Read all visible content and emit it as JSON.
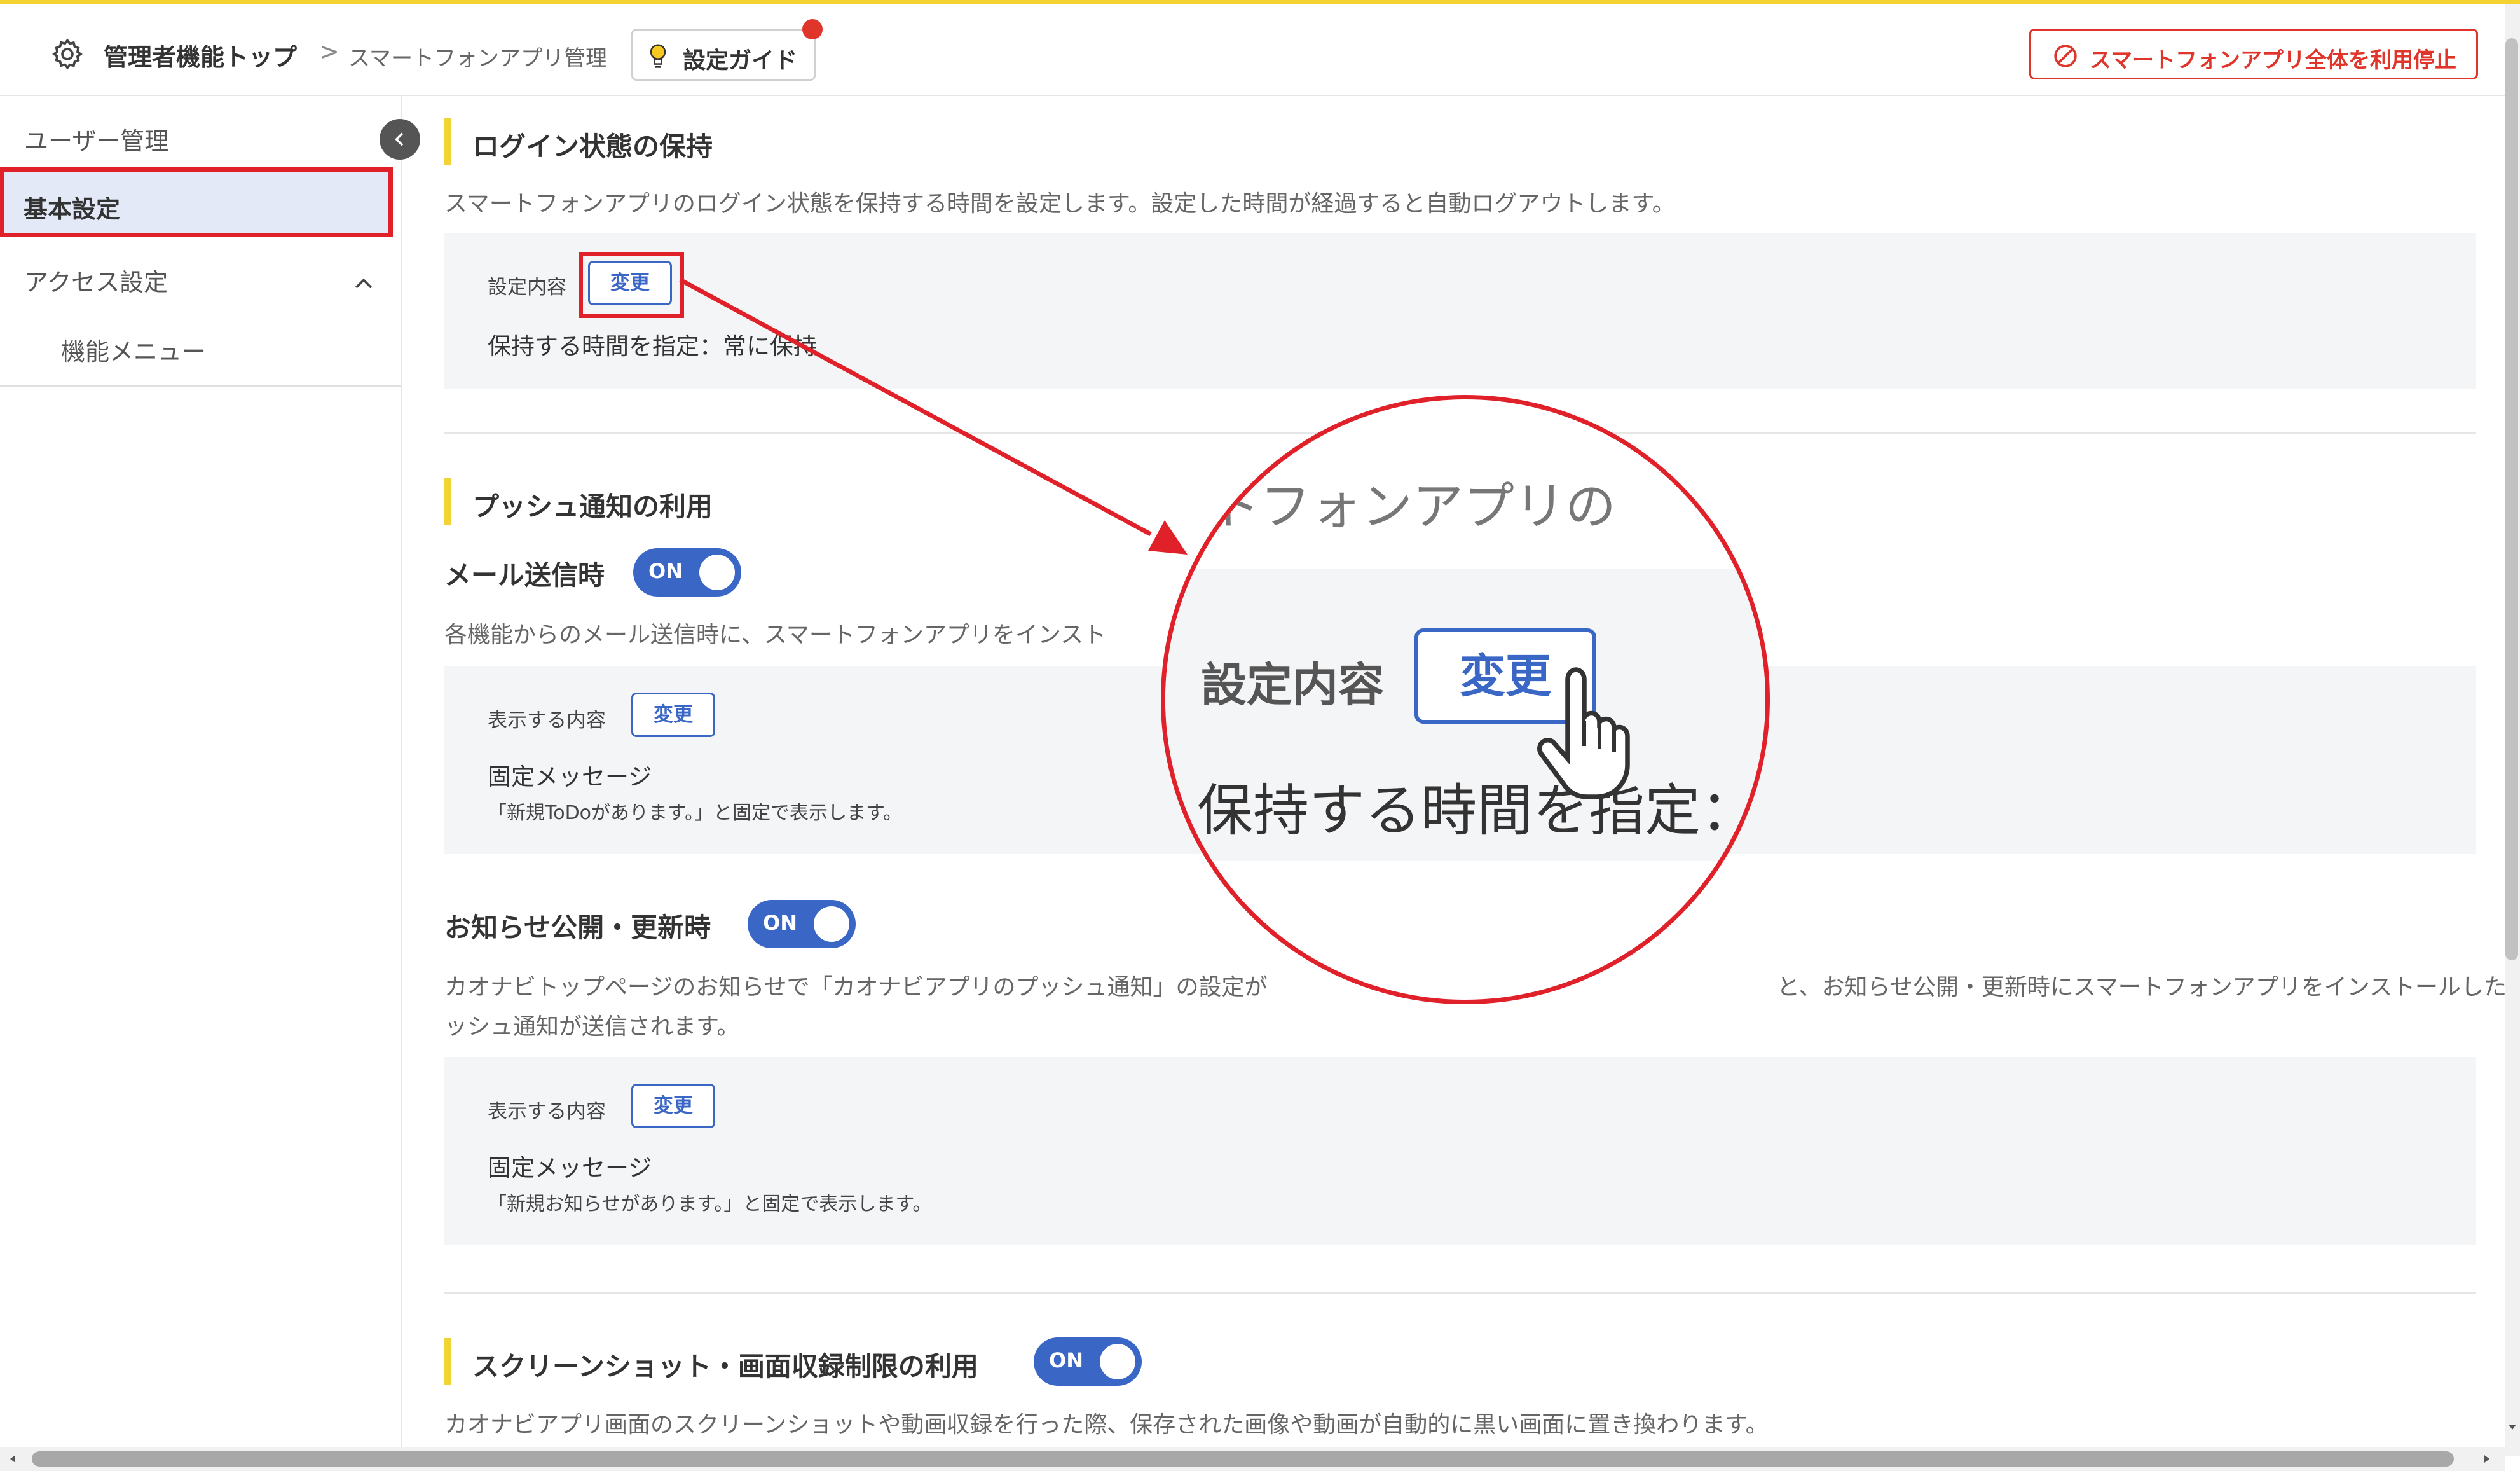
{
  "header": {
    "breadcrumb_home": "管理者機能トップ",
    "breadcrumb_separator": ">",
    "breadcrumb_current": "スマートフォンアプリ管理",
    "guide_label": "設定ガイド",
    "stop_all_label": "スマートフォンアプリ全体を利用停止"
  },
  "sidebar": {
    "items": [
      {
        "label": "ユーザー管理"
      },
      {
        "label": "基本設定",
        "active": true
      },
      {
        "label": "アクセス設定",
        "expanded": true
      },
      {
        "label": "機能メニュー"
      }
    ]
  },
  "sections": {
    "login": {
      "title": "ログイン状態の保持",
      "description": "スマートフォンアプリのログイン状態を保持する時間を設定します。設定した時間が経過すると自動ログアウトします。",
      "setting_label": "設定内容",
      "change_label": "変更",
      "value": "保持する時間を指定：常に保持"
    },
    "push": {
      "title": "プッシュ通知の利用",
      "mail": {
        "title": "メール送信時",
        "toggle": "ON",
        "description": "各機能からのメール送信時に、スマートフォンアプリをインスト",
        "display_label": "表示する内容",
        "change_label": "変更",
        "value": "固定メッセージ",
        "note": "「新規ToDoがあります。」と固定で表示します。"
      },
      "news": {
        "title": "お知らせ公開・更新時",
        "toggle": "ON",
        "description_line1_a": "カオナビトップページのお知らせで「カオナビアプリのプッシュ通知」の設定が",
        "description_line1_b": "と、お知らせ公開・更新時にスマートフォンアプリをインストールした端末にプ",
        "description_line2": "ッシュ通知が送信されます。",
        "display_label": "表示する内容",
        "change_label": "変更",
        "value": "固定メッセージ",
        "note": "「新規お知らせがあります。」と固定で表示します。"
      }
    },
    "screenshot": {
      "title": "スクリーンショット・画面収録制限の利用",
      "toggle": "ON",
      "description": "カオナビアプリ画面のスクリーンショットや動画収録を行った際、保存された画像や動画が自動的に黒い画面に置き換わります。"
    }
  },
  "zoom": {
    "top_text": "-トフォンアプリの",
    "setting_label": "設定内容",
    "change_label": "変更",
    "value_text": "保持する時間を指定：常"
  },
  "colors": {
    "accent_yellow": "#f2d331",
    "primary_blue": "#3a66c5",
    "annotation_red": "#e0212a",
    "active_bg": "#e3e9f6"
  }
}
